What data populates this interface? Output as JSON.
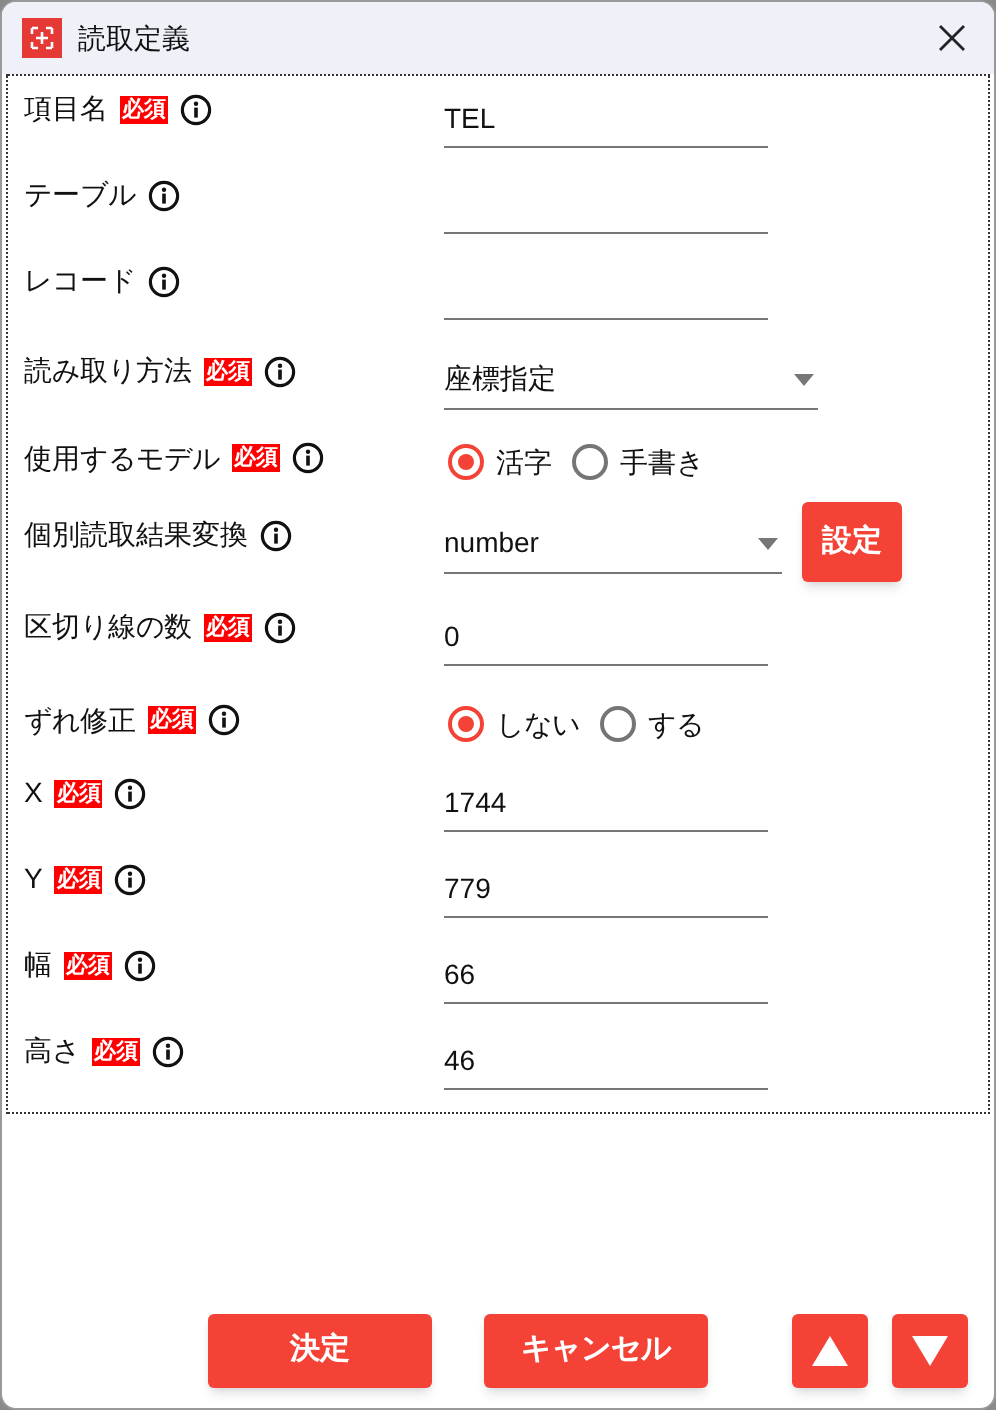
{
  "window": {
    "title": "読取定義"
  },
  "fields": [
    {
      "kind": "text",
      "label": "項目名",
      "required": true,
      "badge": "必須",
      "value": "TEL"
    },
    {
      "kind": "text",
      "label": "テーブル",
      "required": false
    },
    {
      "kind": "text",
      "label": "レコード",
      "required": false
    },
    {
      "kind": "select",
      "label": "読み取り方法",
      "required": true,
      "badge": "必須",
      "value": "座標指定"
    },
    {
      "kind": "radio",
      "label": "使用するモデル",
      "required": true,
      "badge": "必須",
      "options": [
        {
          "label": "活字",
          "selected": true
        },
        {
          "label": "手書き",
          "selected": false
        }
      ]
    },
    {
      "kind": "select",
      "label": "個別読取結果変換",
      "required": false,
      "value": "number",
      "button": "設定"
    },
    {
      "kind": "text",
      "label": "区切り線の数",
      "required": true,
      "badge": "必須",
      "value": "0"
    },
    {
      "kind": "radio",
      "label": "ずれ修正",
      "required": true,
      "badge": "必須",
      "options": [
        {
          "label": "しない",
          "selected": true
        },
        {
          "label": "する",
          "selected": false
        }
      ]
    },
    {
      "kind": "text",
      "label": "X",
      "required": true,
      "badge": "必須",
      "value": "1744"
    },
    {
      "kind": "text",
      "label": "Y",
      "required": true,
      "badge": "必須",
      "value": "779"
    },
    {
      "kind": "text",
      "label": "幅",
      "required": true,
      "badge": "必須",
      "value": "66"
    },
    {
      "kind": "text",
      "label": "高さ",
      "required": true,
      "badge": "必須",
      "value": "46"
    }
  ],
  "buttons": [
    {
      "kind": "text",
      "label": "決定"
    },
    {
      "kind": "text",
      "label": "キャンセル"
    },
    {
      "kind": "up"
    },
    {
      "kind": "down"
    }
  ]
}
